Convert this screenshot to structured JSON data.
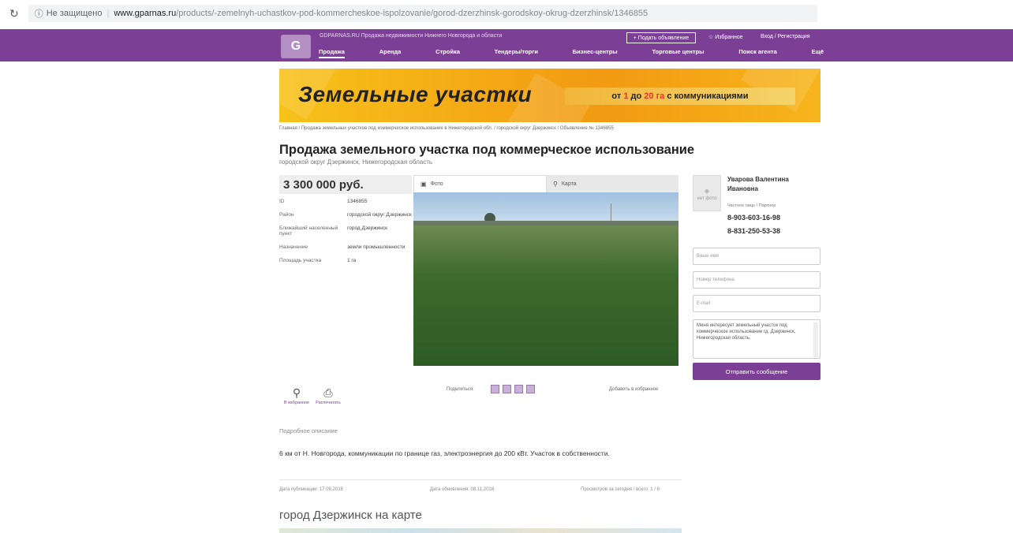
{
  "browser": {
    "reload_icon": "reload-icon",
    "security": "Не защищено",
    "host": "www.gparnas.ru",
    "path": "/products/-zemelnyh-uchastkov-pod-kommercheskoe-ispolzovanie/gorod-dzerzhinsk-gorodskoy-okrug-dzerzhinsk/1346855"
  },
  "header": {
    "logo": "G",
    "site_name": "GDPARNAS.RU  Продажа недвижимости Нижнего Новгорода и области",
    "add_listing": "+ Подать объявление",
    "favorites": "☆ Избранное",
    "login": "Вход / Регистрация",
    "nav": [
      "Продажа",
      "Аренда",
      "Стройка",
      "Тендеры/торги",
      "Бизнес-центры",
      "Торговые центры",
      "Поиск агента",
      "Ещё"
    ]
  },
  "banner": {
    "title": "Земельные участки",
    "offer_prefix": "от ",
    "offer_1": "1",
    "offer_mid": " до ",
    "offer_20": "20 га",
    "offer_suffix": " с коммуникациями"
  },
  "breadcrumb": "Главная / Продажа земельных участков под коммерческое использование в Нижегородской обл. / городской округ Дзержинск / Объявление № 1346855",
  "title": "Продажа земельного участка под коммерческое использование",
  "subtitle": "городской округ Дзержинск, Нижегородская область",
  "price": "3 300 000 руб.",
  "details": [
    {
      "k": "ID",
      "v": "1346855"
    },
    {
      "k": "Район",
      "v": "городской округ Дзержинск"
    },
    {
      "k": "Ближайший населенный пункт",
      "v": "город Дзержинск"
    },
    {
      "k": "Назначение",
      "v": "земли промышленности"
    },
    {
      "k": "Площадь участка",
      "v": "1 га"
    }
  ],
  "tabs": {
    "photo": "Фото",
    "map": "Карта"
  },
  "actions": {
    "favorite": "В избранное",
    "print": "Распечатать"
  },
  "share": {
    "label": "Поделиться:"
  },
  "fav_add": "Добавить в избранное",
  "description": {
    "head": "Подробное описание",
    "body": "6 км от Н. Новгорода, коммуникации по границе газ, электроэнергия до 200 кВт. Участок в собственности."
  },
  "meta": {
    "created": "Дата публикации: 17.09.2018",
    "updated": "Дата обновления: 08.11.2018",
    "views": "Просмотров за сегодня / всего: 1 / 8"
  },
  "map_title": "город Дзержинск на карте",
  "contact": {
    "photo_label": "нет фото",
    "name": "Уварова Валентина Ивановна",
    "note": "Частное лицо / Партнер",
    "phone1": "8-903-603-16-98",
    "phone2": "8-831-250-53-38",
    "name_ph": "Ваше имя",
    "phone_ph": "Номер телефона",
    "email_ph": "E-mail",
    "message": "Меня интересует земельный участок под коммерческое использование гд. Дзержинск, Нижегородская область.",
    "send": "Отправить сообщение"
  },
  "colors": {
    "brand": "#7c3f96",
    "banner": "#f29a12"
  }
}
